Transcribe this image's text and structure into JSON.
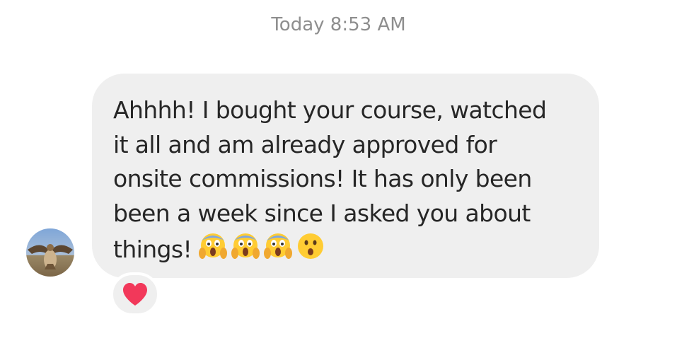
{
  "timestamp": "Today 8:53 AM",
  "message": {
    "lines": [
      "Ahhhh! I bought your course, watched",
      "it all and am already approved for",
      "onsite commissions! It has only been",
      "been a week since I asked you about",
      "things!"
    ],
    "emojis": [
      "face-screaming-in-fear-icon",
      "face-screaming-in-fear-icon",
      "face-screaming-in-fear-icon",
      "face-with-open-mouth-icon"
    ]
  },
  "reaction": {
    "icon": "heart-icon",
    "color": "#f2385a"
  },
  "colors": {
    "bubble": "#efefef",
    "timestamp": "#8e8e8e",
    "text": "#262626"
  }
}
